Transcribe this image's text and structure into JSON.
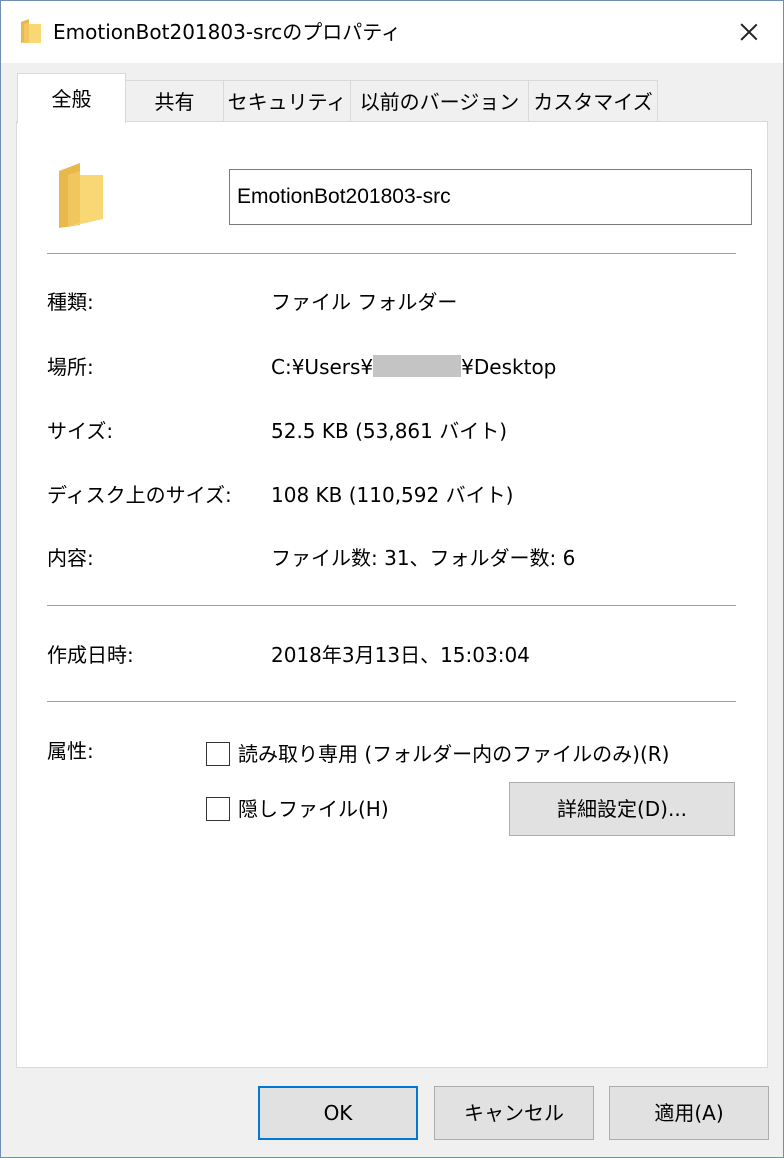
{
  "window": {
    "title": "EmotionBot201803-srcのプロパティ",
    "title_icon": "folder-icon",
    "close_icon": "close-icon"
  },
  "tabs": [
    {
      "label": "全般",
      "active": true
    },
    {
      "label": "共有",
      "active": false
    },
    {
      "label": "セキュリティ",
      "active": false
    },
    {
      "label": "以前のバージョン",
      "active": false
    },
    {
      "label": "カスタマイズ",
      "active": false
    }
  ],
  "general": {
    "folder_icon": "folder-icon",
    "name_value": "EmotionBot201803-src",
    "type_label": "種類:",
    "type_value": "ファイル フォルダー",
    "location_label": "場所:",
    "location_prefix": "C:¥Users¥",
    "location_suffix": "¥Desktop",
    "size_label": "サイズ:",
    "size_value": "52.5 KB (53,861 バイト)",
    "disk_size_label": "ディスク上のサイズ:",
    "disk_size_value": "108 KB (110,592 バイト)",
    "contents_label": "内容:",
    "contents_value": "ファイル数: 31、フォルダー数: 6",
    "created_label": "作成日時:",
    "created_value": "2018年3月13日、15:03:04",
    "attributes_label": "属性:",
    "readonly_label": "読み取り専用 (フォルダー内のファイルのみ)(R)",
    "readonly_checked": false,
    "hidden_label": "隠しファイル(H)",
    "hidden_checked": false,
    "advanced_button": "詳細設定(D)..."
  },
  "footer": {
    "ok": "OK",
    "cancel": "キャンセル",
    "apply": "適用(A)"
  },
  "colors": {
    "folder_yellow": "#f8d775",
    "folder_back": "#e8b84a",
    "default_button_border": "#0078d7"
  }
}
